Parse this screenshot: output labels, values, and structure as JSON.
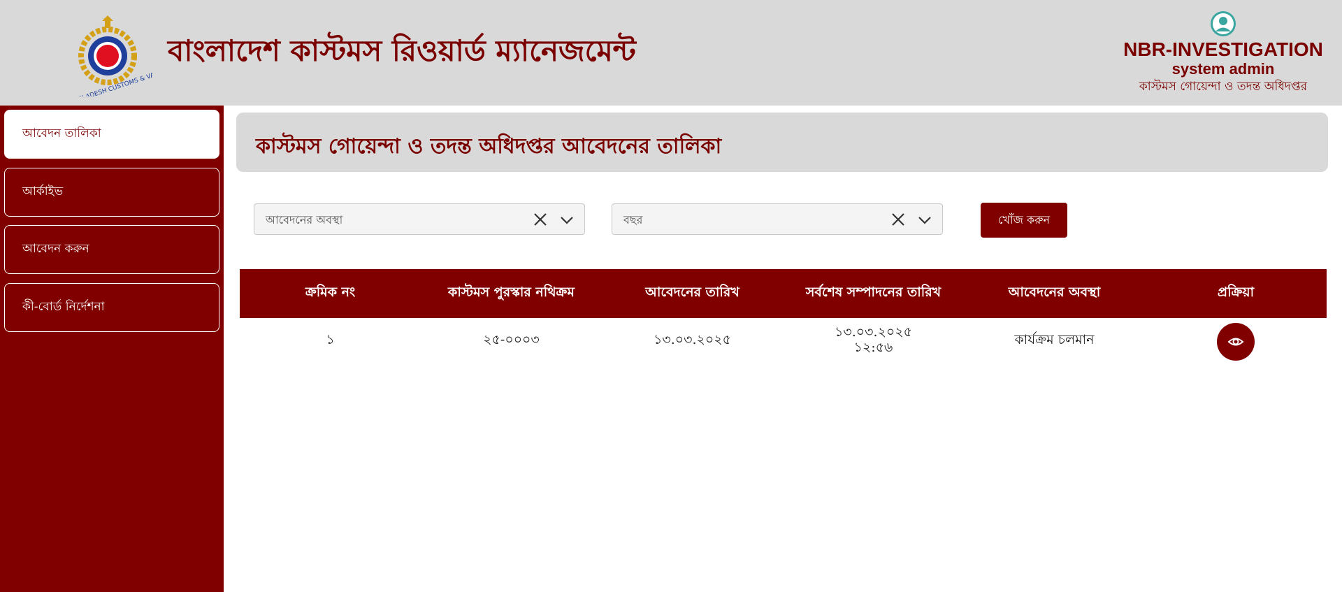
{
  "header": {
    "app_title": "বাংলাদেশ কাস্টমস রিওয়ার্ড ম্যানেজমেন্ট",
    "logo_text": "BANGLADESH CUSTOMS & VAT",
    "user": {
      "name": "NBR-INVESTIGATION",
      "role": "system admin",
      "department": "কাস্টমস গোয়েন্দা ও তদন্ত অধিদপ্তর"
    }
  },
  "sidebar": {
    "items": [
      {
        "label": "আবেদন তালিকা",
        "active": true
      },
      {
        "label": "আর্কাইভ",
        "active": false
      },
      {
        "label": "আবেদন করুন",
        "active": false
      },
      {
        "label": "কী-বোর্ড নির্দেশনা",
        "active": false
      }
    ]
  },
  "main": {
    "page_title": "কাস্টমস গোয়েন্দা ও তদন্ত অধিদপ্তর আবেদনের তালিকা",
    "filters": {
      "status_placeholder": "আবেদনের অবস্থা",
      "year_placeholder": "বছর",
      "search_label": "খোঁজ করুন"
    },
    "table": {
      "headers": [
        "ক্রমিক নং",
        "কাস্টমস পুরস্কার নথিক্রম",
        "আবেদনের তারিখ",
        "সর্বশেষ সম্পাদনের তারিখ",
        "আবেদনের অবস্থা",
        "প্রক্রিয়া"
      ],
      "rows": [
        {
          "serial": "১",
          "file_no": "২৫-০০০৩",
          "applied_date": "১৩.০৩.২০২৫",
          "last_edit_date": "১৩.০৩.২০২৫",
          "last_edit_time": "১২:৫৬",
          "status": "কার্যক্রম চলমান",
          "action_icon": "eye-icon"
        }
      ]
    }
  },
  "colors": {
    "brand": "#800000",
    "header_bg": "#d9d9d9",
    "text_on_brand": "#ffffff"
  }
}
